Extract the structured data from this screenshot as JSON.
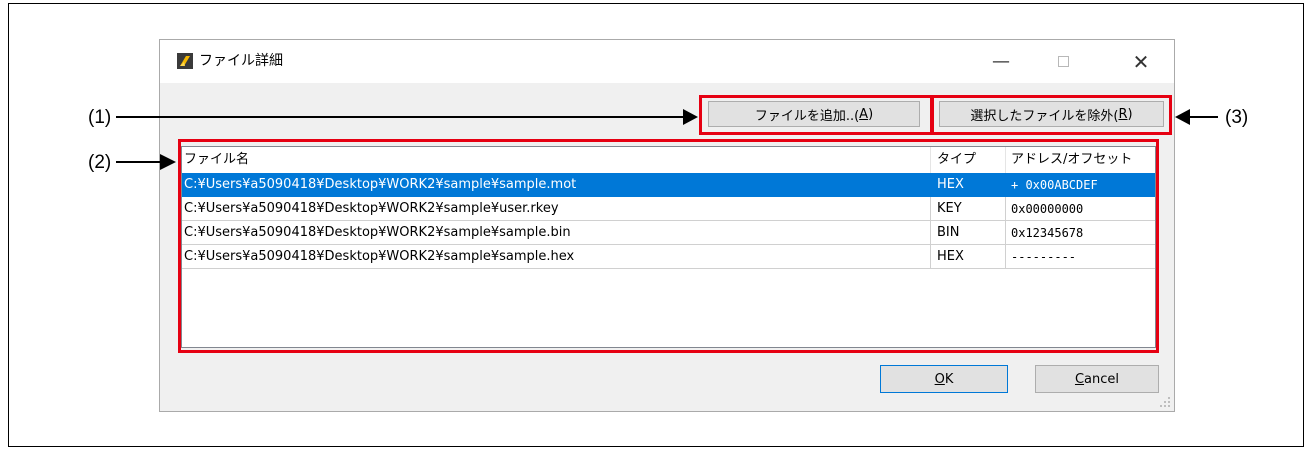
{
  "window": {
    "title": "ファイル詳細",
    "icon": "app-icon",
    "controls": {
      "minimize": "—",
      "close": "✕"
    }
  },
  "buttons": {
    "add": {
      "label": "ファイルを追加..(",
      "key": "A",
      "suffix": ")"
    },
    "remove": {
      "label": "選択したファイルを除外(",
      "key": "R",
      "suffix": ")"
    },
    "ok": {
      "key": "O",
      "rest": "K"
    },
    "cancel": {
      "key": "C",
      "rest": "ancel"
    }
  },
  "table": {
    "columns": [
      "ファイル名",
      "タイプ",
      "アドレス/オフセット"
    ],
    "rows": [
      {
        "name": "C:¥Users¥a5090418¥Desktop¥WORK2¥sample¥sample.mot",
        "type": "HEX",
        "address": "+ 0x00ABCDEF",
        "selected": true
      },
      {
        "name": "C:¥Users¥a5090418¥Desktop¥WORK2¥sample¥user.rkey",
        "type": "KEY",
        "address": "0x00000000",
        "selected": false
      },
      {
        "name": "C:¥Users¥a5090418¥Desktop¥WORK2¥sample¥sample.bin",
        "type": "BIN",
        "address": "0x12345678",
        "selected": false
      },
      {
        "name": "C:¥Users¥a5090418¥Desktop¥WORK2¥sample¥sample.hex",
        "type": "HEX",
        "address": "---------",
        "selected": false
      }
    ]
  },
  "callouts": {
    "c1": "(1)",
    "c2": "(2)",
    "c3": "(3)"
  },
  "colors": {
    "highlight": "#e60012",
    "selection": "#0078d7",
    "dialog_bg": "#f0f0f0"
  }
}
